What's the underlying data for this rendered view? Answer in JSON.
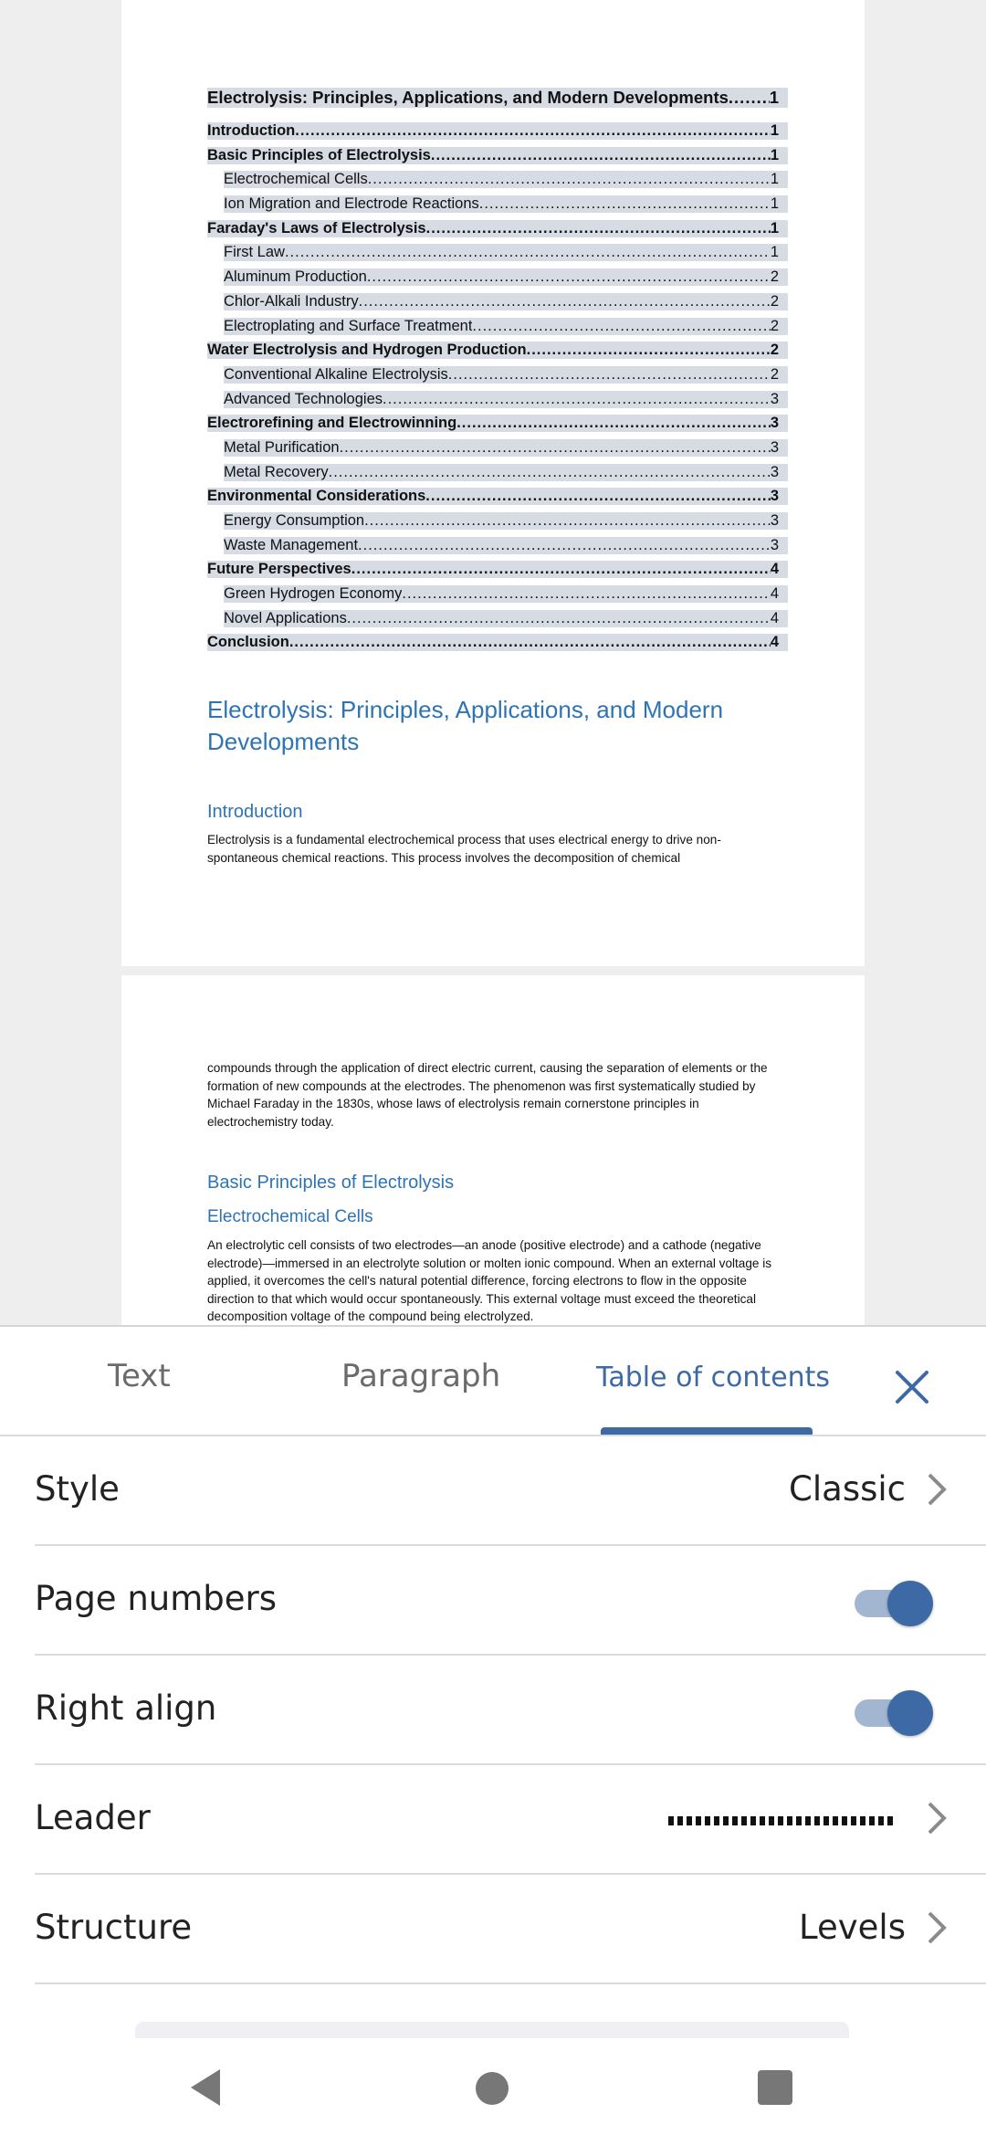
{
  "document": {
    "toc": [
      {
        "level": 0,
        "title": "Electrolysis: Principles, Applications, and Modern Developments",
        "page": "1"
      },
      {
        "level": 1,
        "title": "Introduction",
        "page": "1"
      },
      {
        "level": 1,
        "title": "Basic Principles of Electrolysis",
        "page": "1"
      },
      {
        "level": 2,
        "title": "Electrochemical Cells",
        "page": "1"
      },
      {
        "level": 2,
        "title": "Ion Migration and Electrode Reactions",
        "page": "1"
      },
      {
        "level": 1,
        "title": "Faraday's Laws of Electrolysis",
        "page": "1"
      },
      {
        "level": 2,
        "title": "First Law",
        "page": "1"
      },
      {
        "level": 2,
        "title": "Aluminum Production",
        "page": "2"
      },
      {
        "level": 2,
        "title": "Chlor-Alkali Industry",
        "page": "2"
      },
      {
        "level": 2,
        "title": "Electroplating and Surface Treatment",
        "page": "2"
      },
      {
        "level": 1,
        "title": "Water Electrolysis and Hydrogen Production",
        "page": "2"
      },
      {
        "level": 2,
        "title": "Conventional Alkaline Electrolysis",
        "page": "2"
      },
      {
        "level": 2,
        "title": "Advanced Technologies",
        "page": "3"
      },
      {
        "level": 1,
        "title": "Electrorefining and Electrowinning",
        "page": "3"
      },
      {
        "level": 2,
        "title": "Metal Purification",
        "page": "3"
      },
      {
        "level": 2,
        "title": "Metal Recovery",
        "page": "3"
      },
      {
        "level": 1,
        "title": "Environmental Considerations",
        "page": "3"
      },
      {
        "level": 2,
        "title": "Energy Consumption",
        "page": "3"
      },
      {
        "level": 2,
        "title": "Waste Management",
        "page": "3"
      },
      {
        "level": 1,
        "title": "Future Perspectives",
        "page": "4"
      },
      {
        "level": 2,
        "title": "Green Hydrogen Economy",
        "page": "4"
      },
      {
        "level": 2,
        "title": "Novel Applications",
        "page": "4"
      },
      {
        "level": 1,
        "title": "Conclusion",
        "page": "4"
      }
    ],
    "heading": "Electrolysis: Principles, Applications, and Modern Developments",
    "intro_heading": "Introduction",
    "intro_text_1": "Electrolysis is a fundamental electrochemical process that uses electrical energy to drive non-spontaneous chemical reactions. This process involves the decomposition of chemical",
    "intro_text_2": "compounds through the application of direct electric current, causing the separation of elements or the formation of new compounds at the electrodes. The phenomenon was first systematically studied by Michael Faraday in the 1830s, whose laws of electrolysis remain cornerstone principles in electrochemistry today.",
    "basic_heading": "Basic Principles of Electrolysis",
    "cells_heading": "Electrochemical Cells",
    "cells_text": "An electrolytic cell consists of two electrodes—an anode (positive electrode) and a cathode (negative electrode)—immersed in an electrolyte solution or molten ionic compound. When an external voltage is applied, it overcomes the cell's natural potential difference, forcing electrons to flow in the opposite direction to that which would occur spontaneously. This external voltage must exceed the theoretical decomposition voltage of the compound being electrolyzed."
  },
  "panel": {
    "tabs": [
      {
        "label": "Text",
        "active": false
      },
      {
        "label": "Paragraph",
        "active": false
      },
      {
        "label": "Table of contents",
        "active": true
      }
    ],
    "rows": {
      "style": {
        "label": "Style",
        "value": "Classic"
      },
      "page_numbers": {
        "label": "Page numbers",
        "on": true
      },
      "right_align": {
        "label": "Right align",
        "on": true
      },
      "leader": {
        "label": "Leader",
        "value": "dotted"
      },
      "structure": {
        "label": "Structure",
        "value": "Levels"
      }
    },
    "accent_color": "#3d6aa4"
  },
  "navbar": {
    "icons": [
      "back-icon",
      "home-icon",
      "recents-icon"
    ]
  }
}
